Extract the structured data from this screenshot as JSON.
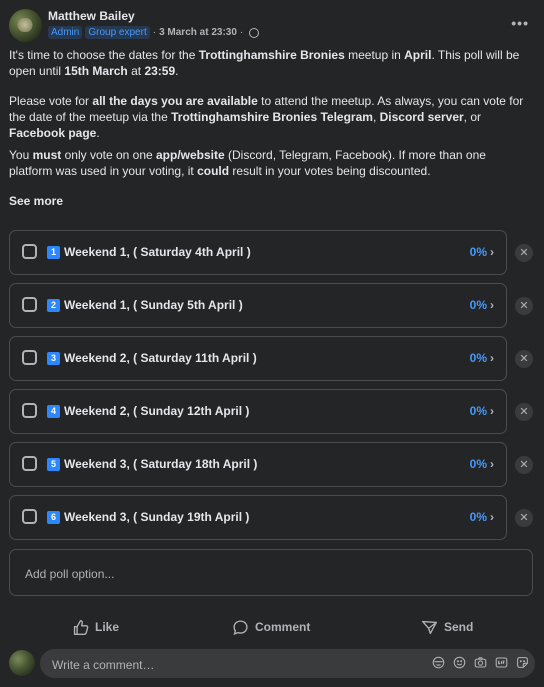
{
  "post": {
    "author": "Matthew Bailey",
    "badges": [
      "Admin",
      "Group expert"
    ],
    "dot": "·",
    "timestamp": "3 March at 23:30",
    "timestamp_sep": "·",
    "more": "•••"
  },
  "body": {
    "p1": {
      "t1": "It's time to choose the dates for the ",
      "b1": "Trottinghamshire Bronies",
      "t2": " meetup in ",
      "b2": "April",
      "t3": ". This poll will be open until ",
      "b3": "15th March",
      "t4": " at ",
      "b4": "23:59",
      "t5": "."
    },
    "p2": {
      "t1": "Please vote for ",
      "b1": "all the days you are available",
      "t2": " to attend the meetup. As always, you can vote for the date of the meetup via the ",
      "b2": "Trottinghamshire Bronies Telegram",
      "t3": ", ",
      "b3": "Discord server",
      "t4": ", or ",
      "b4": "Facebook page",
      "t5": "."
    },
    "p3": {
      "t1": "You ",
      "b1": "must",
      "t2": " only vote on one ",
      "b2": "app/website",
      "t3": " (Discord, Telegram, Facebook). If more than one platform was used in your voting, it ",
      "b3": "could",
      "t4": " result in your votes being discounted."
    },
    "see_more": "See more"
  },
  "poll": {
    "options": [
      {
        "num": "1",
        "label": "Weekend 1, ( Saturday 4th April )",
        "percent": "0%"
      },
      {
        "num": "2",
        "label": "Weekend 1, ( Sunday 5th April )",
        "percent": "0%"
      },
      {
        "num": "3",
        "label": "Weekend 2, ( Saturday 11th April )",
        "percent": "0%"
      },
      {
        "num": "4",
        "label": "Weekend 2, ( Sunday 12th April )",
        "percent": "0%"
      },
      {
        "num": "5",
        "label": "Weekend 3, ( Saturday 18th April )",
        "percent": "0%"
      },
      {
        "num": "6",
        "label": "Weekend 3, ( Sunday 19th April )",
        "percent": "0%"
      }
    ],
    "add_placeholder": "Add poll option..."
  },
  "actions": {
    "like": "Like",
    "comment": "Comment",
    "send": "Send"
  },
  "comment": {
    "placeholder": "Write a comment…"
  },
  "colors": {
    "background": "#242526",
    "accent": "#4599ff",
    "text": "#e4e6eb",
    "muted": "#b0b3b8"
  }
}
